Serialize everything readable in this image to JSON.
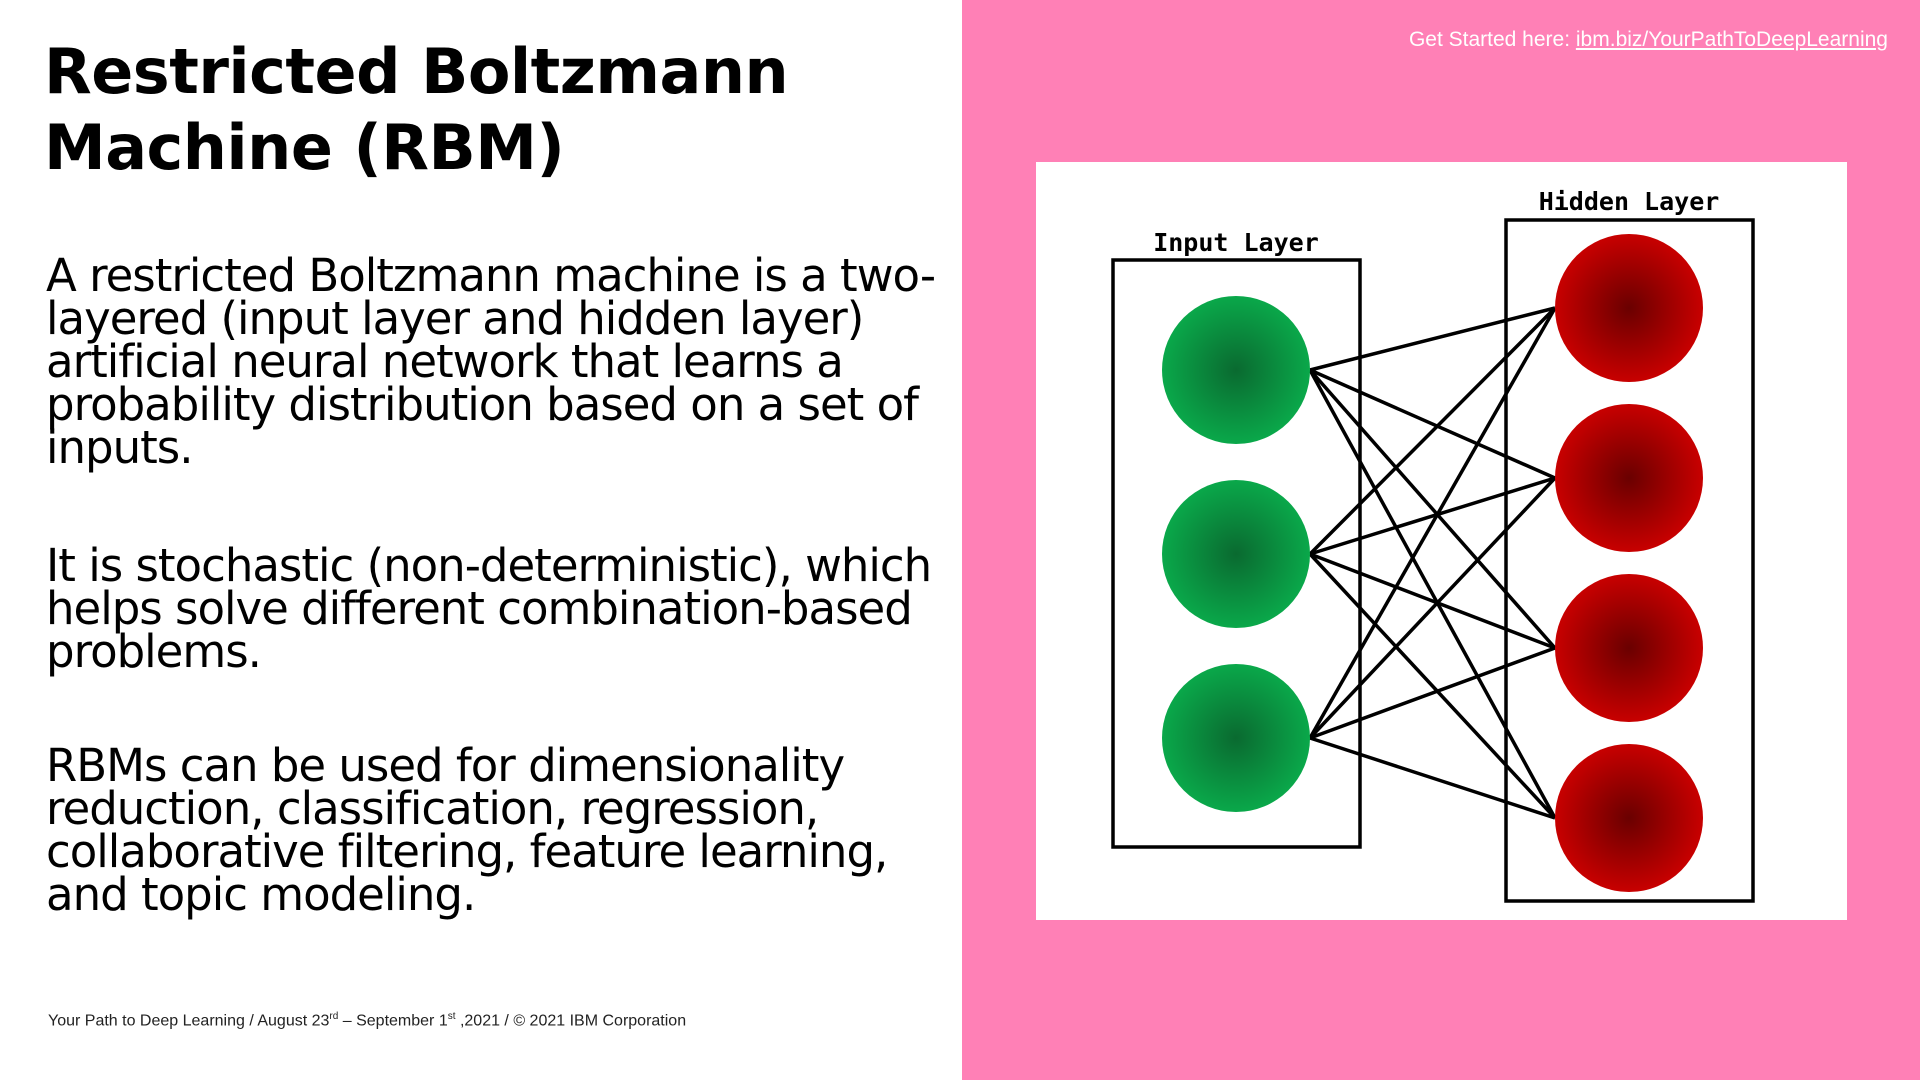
{
  "slide": {
    "title": "Restricted Boltzmann Machine (RBM)",
    "paragraphs": [
      "A restricted Boltzmann machine is a two-layered (input layer and hidden layer) artificial neural network that learns a probability distribution based on a set of inputs.",
      "It is stochastic (non-deterministic), which helps solve different combination-based problems.",
      "RBMs can be used for dimensionality reduction, classification, regression, collaborative filtering, feature learning, and topic modeling."
    ],
    "footer": {
      "part1": "Your Path to Deep Learning / August 23",
      "sup1": "rd",
      "part2": " – September 1",
      "sup2": "st",
      "part3": " ,2021 / © 2021 IBM Corporation"
    },
    "get_started": {
      "label": "Get Started here: ",
      "link_text": "ibm.biz/YourPathToDeepLearning"
    }
  },
  "diagram": {
    "input_label": "Input Layer",
    "hidden_label": "Hidden Layer",
    "input_node_count": 3,
    "hidden_node_count": 4,
    "colors": {
      "panel_bg": "#ff80b6",
      "input_node_center": "#0a6a30",
      "input_node_edge": "#0aa84a",
      "hidden_node_center": "#6a0000",
      "hidden_node_edge": "#c80000",
      "edge": "#000000"
    }
  }
}
